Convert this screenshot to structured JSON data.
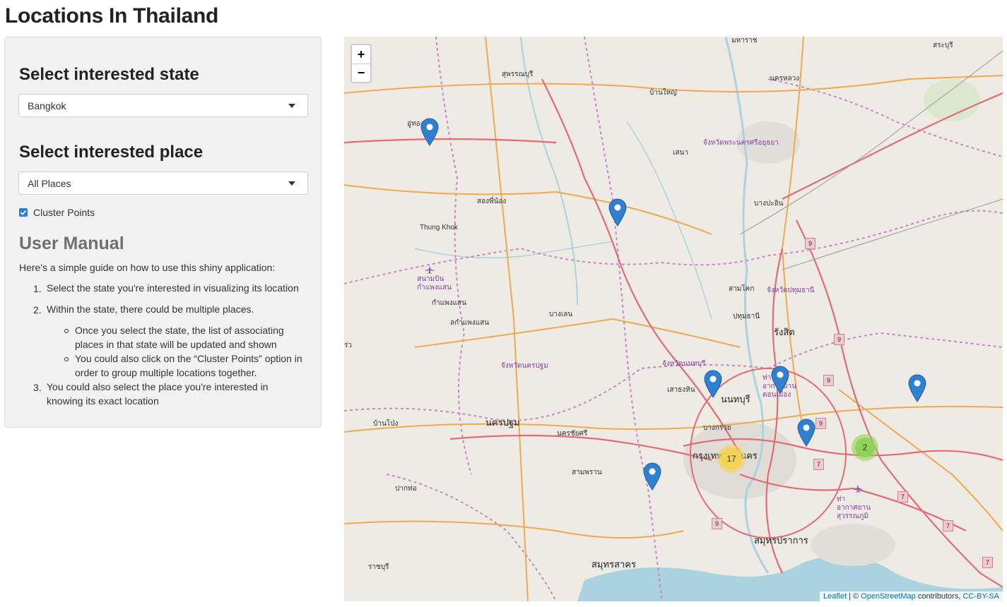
{
  "app": {
    "title": "Locations In Thailand"
  },
  "sidebar": {
    "state_heading": "Select interested state",
    "state_value": "Bangkok",
    "place_heading": "Select interested place",
    "place_value": "All Places",
    "cluster_label": "Cluster Points",
    "cluster_checked": true
  },
  "manual": {
    "title": "User Manual",
    "intro": "Here's a simple guide on how to use this shiny application:",
    "items": [
      {
        "num": "1.",
        "text": "Select the state you're interested in visualizing its location"
      },
      {
        "num": "2.",
        "text": "Within the state, there could be multiple places."
      },
      {
        "num": "3.",
        "text": "You could also select the place you're interested in knowing its exact location"
      }
    ],
    "subitems": [
      "Once you select the state, the list of associating places in that state will be updated and shown",
      "You could also click on the “Cluster Points” option in order to group multiple locations together."
    ]
  },
  "map": {
    "zoom_in": "+",
    "zoom_out": "−",
    "attribution": {
      "leaflet": "Leaflet",
      "sep": " | © ",
      "osm": "OpenStreetMap",
      "contrib": " contributors, ",
      "license": "CC-BY-SA"
    },
    "clusters": [
      {
        "count": "17",
        "color": "#f1d357"
      },
      {
        "count": "2",
        "color": "#8fd35a"
      }
    ],
    "labels": {
      "suphanburi": "สุพรรณบุรี",
      "ban_yai": "บ้านใหญ่",
      "ayutthaya_prov": "จังหวัดพระนครศรีอยุธยา",
      "sena": "เสนา",
      "song_phi_nong": "สองพี่น้อง",
      "thung_khok": "Thung Khok",
      "bang_pa_in": "บางปะอิน",
      "sam_khok": "สามโคก",
      "pathum_prov": "จังหวัดปทุมธานี",
      "pathum_thani": "ปทุมธานี",
      "rangsit": "รังสิต",
      "kamphaeng_saen_airport": "สนามบินกำแพงแสน",
      "kamphaeng_saen": "กำแพงแสน",
      "lak_kamphaeng_saen": "ลกำแพงแสน",
      "bang_len": "บางเลน",
      "nakhon_pathom_prov": "จังหวัดนครปฐม",
      "nonthaburi_prov": "จังหวัดนนทบุรี",
      "sao_thong_hin": "เสาธงหิน",
      "nonthaburi": "นนทบุรี",
      "don_mueang": "ท่าอากาศยานดอนเมือง",
      "nakhon_pathom": "นครปฐม",
      "nakhon_chaisi": "นครชัยศรี",
      "bang_kruai": "บางกรวย",
      "bangkok": "กรุงเทพมหานคร",
      "sam_phran": "สามพราน",
      "suvarnabhumi": "ท่าอากาศยานสุวรรณภูมิ",
      "samut_prakan": "สมุทรปราการ",
      "samut_sakhon": "สมุทรสาคร",
      "ban_pong": "บ้านโป่ง",
      "pak_tho": "ปากท่อ",
      "ratchaburi": "ราชบุรี",
      "u_thong": "อู่ทอง",
      "nakhon_luang": "นครหลวง",
      "saraburi": "สระบุรี",
      "mahachat": "มหาราช",
      "ratchaburi_left": "ราชบุรี",
      "row": "ร่ว"
    },
    "shields": [
      "9",
      "9",
      "9",
      "9",
      "7",
      "7",
      "7",
      "7",
      "9"
    ]
  }
}
